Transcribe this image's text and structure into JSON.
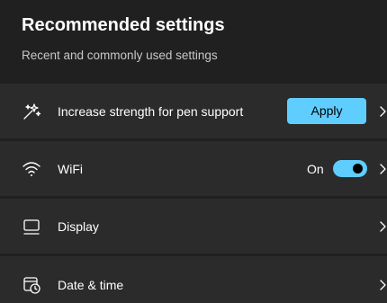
{
  "header": {
    "title": "Recommended settings",
    "subtitle": "Recent and commonly used settings"
  },
  "rows": [
    {
      "label": "Increase strength for pen support",
      "icon": "sparkle-icon",
      "action_label": "Apply"
    },
    {
      "label": "WiFi",
      "icon": "wifi-icon",
      "toggle_state": "On",
      "toggle_on": true
    },
    {
      "label": "Display",
      "icon": "monitor-icon"
    },
    {
      "label": "Date & time",
      "icon": "calendar-clock-icon"
    }
  ],
  "colors": {
    "background": "#202020",
    "row_background": "#2b2b2b",
    "accent": "#60cdff"
  }
}
